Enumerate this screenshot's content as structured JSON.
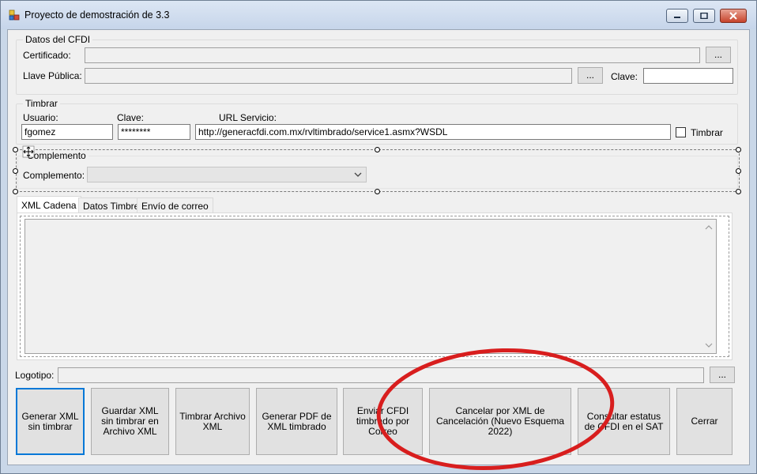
{
  "window": {
    "title": "Proyecto de demostración de 3.3"
  },
  "cfdi": {
    "group_title": "Datos del CFDI",
    "certificado_label": "Certificado:",
    "certificado_value": "",
    "certificado_browse": "...",
    "llave_label": "Llave Pública:",
    "llave_value": "",
    "llave_browse": "...",
    "clave_label": "Clave:",
    "clave_value": ""
  },
  "timbrar": {
    "group_title": "Timbrar",
    "usuario_label": "Usuario:",
    "usuario_value": "fgomez",
    "clave_label": "Clave:",
    "clave_value": "********",
    "url_label": "URL Servicio:",
    "url_value": "http://generacfdi.com.mx/rvltimbrado/service1.asmx?WSDL",
    "timbrar_checkbox_label": "Timbrar"
  },
  "complemento": {
    "group_title": "Complemento",
    "label": "Complemento:",
    "selected": ""
  },
  "tabs": [
    {
      "label": "XML Cadena",
      "active": true
    },
    {
      "label": "Datos Timbre",
      "active": false
    },
    {
      "label": "Envío de correo",
      "active": false
    }
  ],
  "xml_cadena": {
    "value": ""
  },
  "logotipo": {
    "label": "Logotipo:",
    "value": "",
    "browse": "..."
  },
  "buttons": {
    "generar_xml": "Generar XML sin timbrar",
    "guardar_xml": "Guardar XML sin timbrar en Archivo XML",
    "timbrar_archivo": "Timbrar Archivo XML",
    "generar_pdf": "Generar PDF de XML timbrado",
    "enviar_cfdi": "Enviar CFDI timbrado por Correo",
    "cancelar_xml": "Cancelar por XML de Cancelación (Nuevo Esquema 2022)",
    "consultar_estatus": "Consultar estatus de CFDI en el SAT",
    "cerrar": "Cerrar"
  },
  "colors": {
    "annotation_ellipse": "#d81e1e",
    "focus_border": "#0078d7"
  }
}
